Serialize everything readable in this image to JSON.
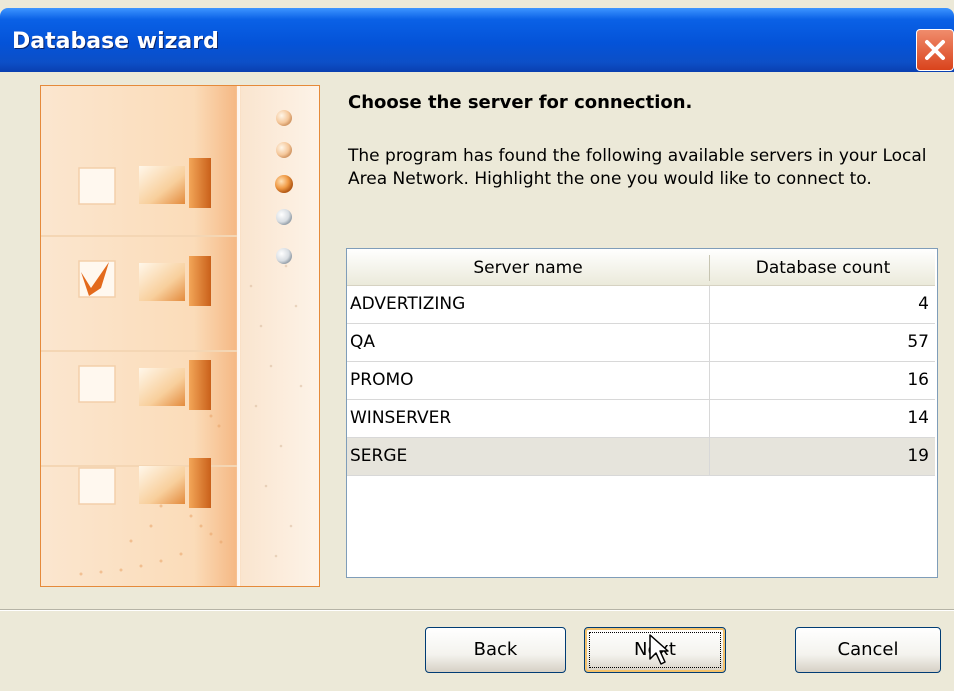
{
  "window": {
    "title": "Database wizard"
  },
  "wizard": {
    "heading": "Choose the server for connection.",
    "description": "The program has found the following available servers in your Local Area Network. Highlight the one you would like to connect to.",
    "steps_total": 5,
    "current_step": 3
  },
  "table": {
    "columns": [
      "Server name",
      "Database count"
    ],
    "rows": [
      {
        "name": "ADVERTIZING",
        "count": "4"
      },
      {
        "name": "QA",
        "count": "57"
      },
      {
        "name": "PROMO",
        "count": "16"
      },
      {
        "name": "WINSERVER",
        "count": "14"
      },
      {
        "name": "SERGE",
        "count": "19"
      }
    ],
    "selected_index": 4
  },
  "buttons": {
    "back": "Back",
    "next": "Next",
    "cancel": "Cancel"
  },
  "colors": {
    "accent_orange": "#e58a3a",
    "titlebar_blue": "#0453d8",
    "selection": "#e6e4dc"
  }
}
